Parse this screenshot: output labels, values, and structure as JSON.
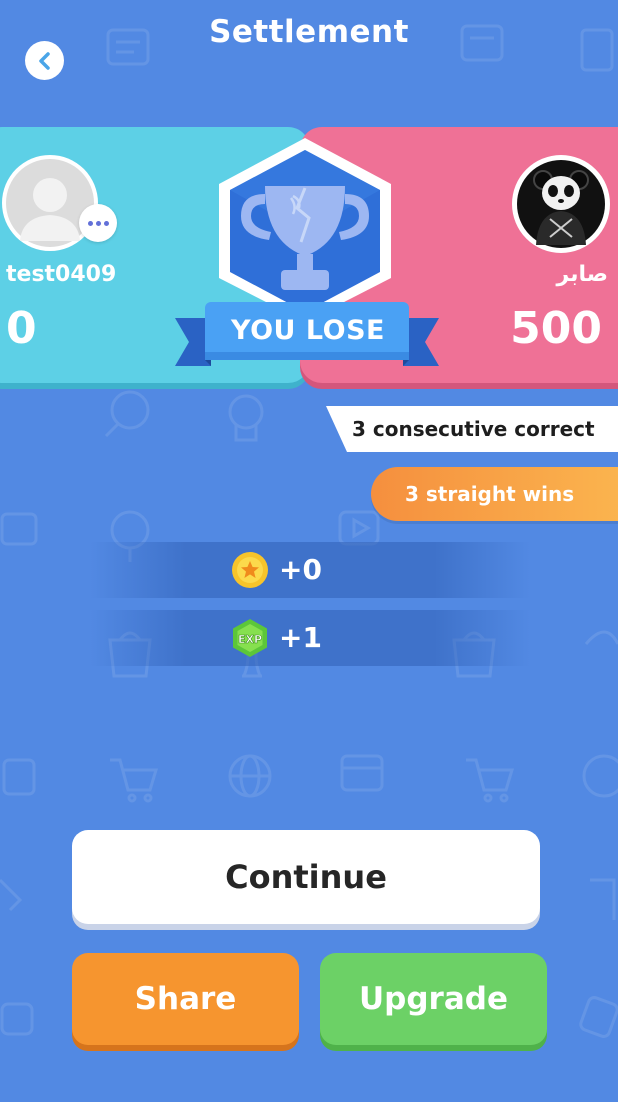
{
  "header": {
    "title": "Settlement",
    "back_icon": "chevron-left-icon"
  },
  "players": {
    "left": {
      "name": "test0409",
      "score": "0",
      "avatar": "default-user-avatar",
      "color": "#5dd0e6"
    },
    "right": {
      "name": "صابر",
      "score": "500",
      "avatar": "panda-avatar",
      "color": "#ef7196"
    }
  },
  "result": {
    "label": "YOU LOSE",
    "icon": "trophy-icon"
  },
  "achievements": {
    "consecutive_correct": "3 consecutive correct",
    "straight_wins": "3 straight wins"
  },
  "rewards": {
    "coins": "+0",
    "coins_icon": "coin-star-icon",
    "exp": "+1",
    "exp_icon": "exp-icon",
    "exp_icon_text": "EXP"
  },
  "buttons": {
    "continue": "Continue",
    "share": "Share",
    "upgrade": "Upgrade"
  },
  "colors": {
    "background": "#5289e3",
    "share": "#f6952f",
    "upgrade": "#6cd166",
    "achievement_orange": "#f58f3e"
  }
}
